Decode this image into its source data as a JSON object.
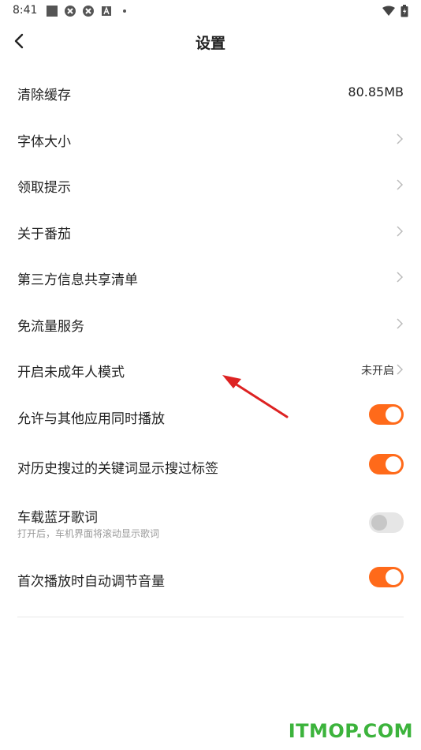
{
  "status": {
    "time": "8:41"
  },
  "header": {
    "title": "设置"
  },
  "items": [
    {
      "label": "清除缓存",
      "value": "80.85MB"
    },
    {
      "label": "字体大小"
    },
    {
      "label": "领取提示"
    },
    {
      "label": "关于番茄"
    },
    {
      "label": "第三方信息共享清单"
    },
    {
      "label": "免流量服务"
    },
    {
      "label": "开启未成年人模式",
      "value": "未开启"
    },
    {
      "label": "允许与其他应用同时播放",
      "toggle": true
    },
    {
      "label": "对历史搜过的关键词显示搜过标签",
      "toggle": true
    },
    {
      "label": "车载蓝牙歌词",
      "sub": "打开后，车机界面将滚动显示歌词",
      "toggle": false
    },
    {
      "label": "首次播放时自动调节音量",
      "toggle": true
    }
  ],
  "colors": {
    "accent": "#ff6a1a",
    "watermark": "#3cb33c",
    "annotation_arrow": "#dd2222"
  },
  "watermark": {
    "text": "ITMOP.COM"
  }
}
